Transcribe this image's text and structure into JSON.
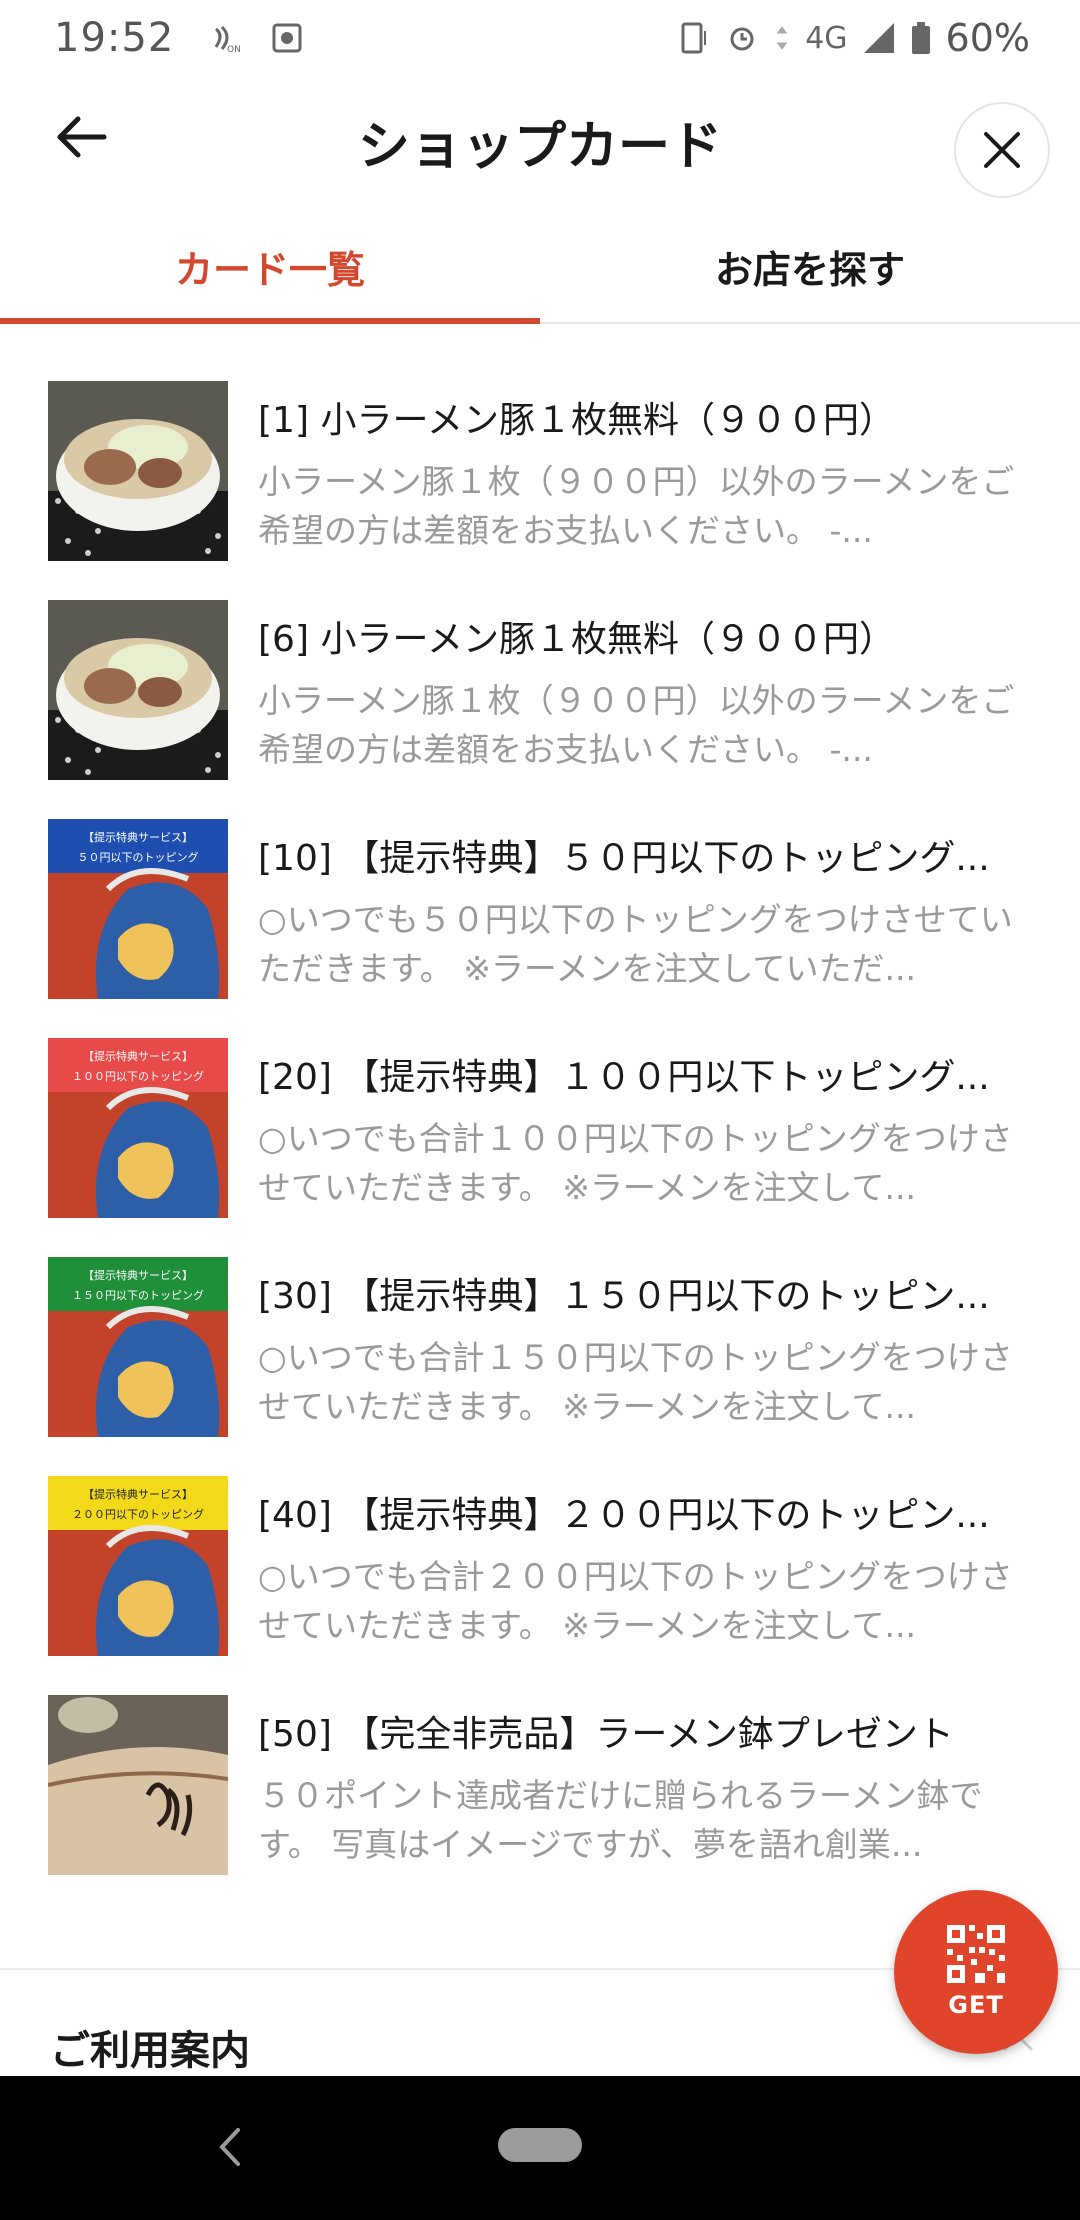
{
  "status_bar": {
    "time": "19:52",
    "network": "4G",
    "battery": "60%"
  },
  "header": {
    "title": "ショップカード",
    "back_icon": "back-arrow-icon",
    "close_icon": "close-icon"
  },
  "tabs": [
    {
      "label": "カード一覧",
      "active": true
    },
    {
      "label": "お店を探す",
      "active": false
    }
  ],
  "items": [
    {
      "title": "[1] 小ラーメン豚１枚無料（９００円）",
      "desc": "小ラーメン豚１枚（９００円）以外のラーメンをご希望の方は差額をお支払いください。 -...",
      "thumb": "ramen"
    },
    {
      "title": "[6] 小ラーメン豚１枚無料（９００円）",
      "desc": "小ラーメン豚１枚（９００円）以外のラーメンをご希望の方は差額をお支払いください。 -...",
      "thumb": "ramen"
    },
    {
      "title": "[10] 【提示特典】５０円以下のトッピング...",
      "desc": "○いつでも５０円以下のトッピングをつけさせていただきます。 ※ラーメンを注文していただ...",
      "thumb": "service",
      "banner_color": "#1e4fb0",
      "banner_line1": "【提示特典サービス】",
      "banner_line2": "５０円以下のトッピング"
    },
    {
      "title": "[20] 【提示特典】１００円以下トッピング...",
      "desc": "○いつでも合計１００円以下のトッピングをつけさせていただきます。 ※ラーメンを注文して...",
      "thumb": "service",
      "banner_color": "#e84a4a",
      "banner_line1": "【提示特典サービス】",
      "banner_line2": "１００円以下のトッピング"
    },
    {
      "title": "[30] 【提示特典】１５０円以下のトッピン...",
      "desc": "○いつでも合計１５０円以下のトッピングをつけさせていただきます。 ※ラーメンを注文して...",
      "thumb": "service",
      "banner_color": "#1f8f3a",
      "banner_line1": "【提示特典サービス】",
      "banner_line2": "１５０円以下のトッピング"
    },
    {
      "title": "[40] 【提示特典】２００円以下のトッピン...",
      "desc": "○いつでも合計２００円以下のトッピングをつけさせていただきます。 ※ラーメンを注文して...",
      "thumb": "service",
      "banner_color": "#f2d91a",
      "banner_line1": "【提示特典サービス】",
      "banner_line2": "２００円以下のトッピング"
    },
    {
      "title": "[50] 【完全非売品】ラーメン鉢プレゼント",
      "desc": "５０ポイント達成者だけに贈られるラーメン鉢です。 写真はイメージですが、夢を語れ創業...",
      "thumb": "bowl"
    }
  ],
  "guide": {
    "title": "ご利用案内"
  },
  "get_button": {
    "label": "GET",
    "icon": "qr-code-icon"
  },
  "nav": {
    "back_icon": "nav-back-icon",
    "home_icon": "nav-home-pill"
  }
}
